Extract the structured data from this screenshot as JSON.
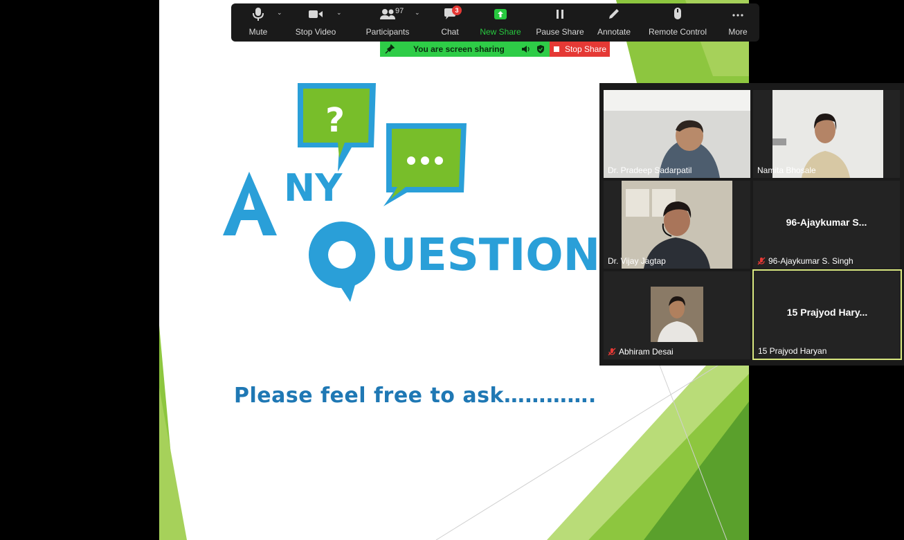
{
  "toolbar": {
    "mute_label": "Mute",
    "stop_video_label": "Stop Video",
    "participants_label": "Participants",
    "participants_count": "97",
    "chat_label": "Chat",
    "chat_badge": "3",
    "new_share_label": "New Share",
    "pause_share_label": "Pause Share",
    "annotate_label": "Annotate",
    "remote_control_label": "Remote Control",
    "more_label": "More"
  },
  "share_bar": {
    "status_text": "You are screen sharing",
    "stop_label": "Stop Share"
  },
  "slide": {
    "logo_word1": "ANY",
    "logo_word2": "QUESTIONS",
    "subtitle": "Please feel free to ask…………."
  },
  "gallery": {
    "tiles": [
      {
        "name": "Dr. Pradeep Sadarpatil"
      },
      {
        "name": "Namita Bhosale"
      },
      {
        "name": "Dr. Vijay Jagtap"
      },
      {
        "name": "96-Ajaykumar S. Singh",
        "display": "96-Ajaykumar S..."
      },
      {
        "name": "Abhiram Desai"
      },
      {
        "name": "15 Prajyod Haryan",
        "display": "15 Prajyod Hary..."
      }
    ]
  },
  "colors": {
    "toolbar_bg": "#1a1a1a",
    "share_green": "#2ecc47",
    "stop_red": "#e53935",
    "slide_blue": "#1f78b4",
    "logo_blue": "#2a9fd8",
    "logo_green": "#78be2a",
    "active_border": "#d9e880"
  },
  "icons": [
    "microphone-icon",
    "video-camera-icon",
    "participants-icon",
    "chat-icon",
    "share-up-arrow-icon",
    "pause-icon",
    "pencil-icon",
    "mouse-icon",
    "more-dots-icon",
    "muted-mic-icon"
  ]
}
